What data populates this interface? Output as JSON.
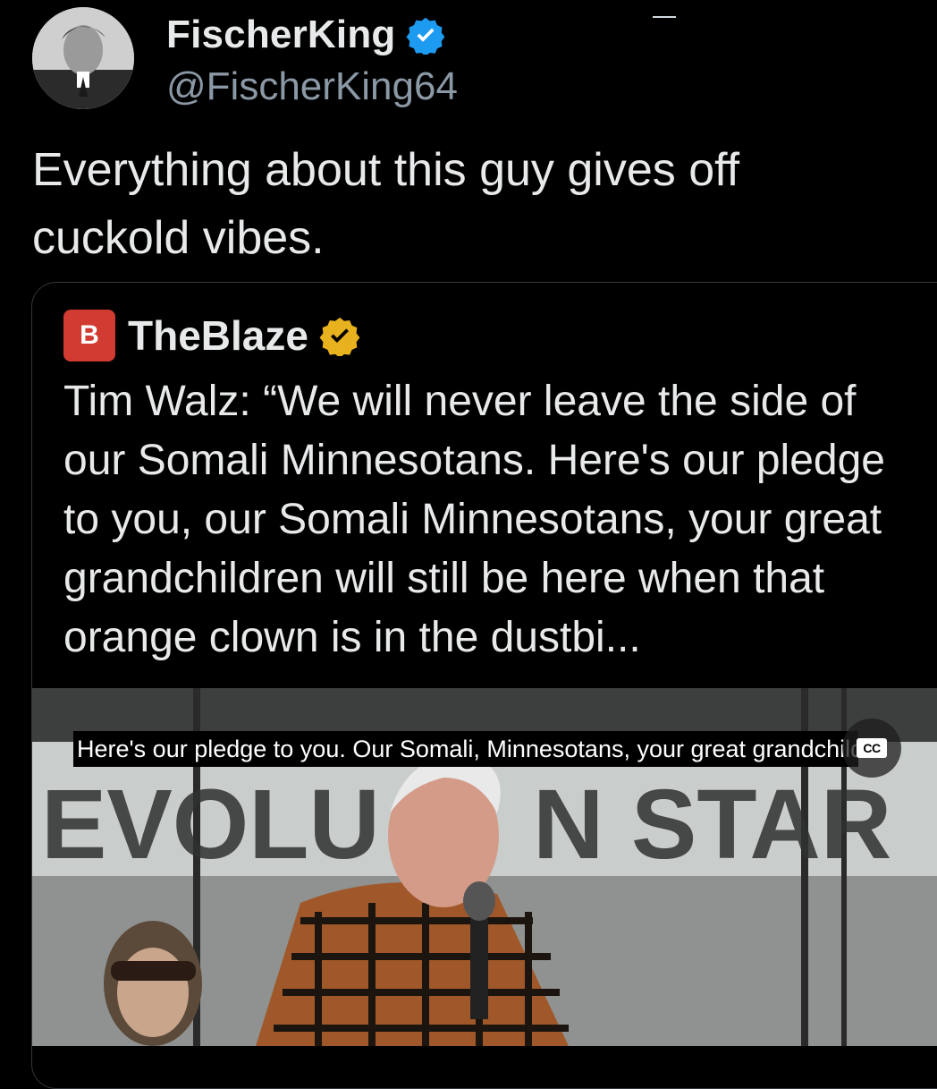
{
  "author": {
    "display_name": "FischerKing",
    "handle": "@FischerKing64",
    "verified_color": "#1d9bf0",
    "avatar_icon": "profile-photo"
  },
  "tweet": {
    "text": "Everything about this guy gives off cuckold vibes."
  },
  "quoted": {
    "logo_text": "B",
    "logo_color": "#d13b32",
    "name": "TheBlaze",
    "badge_color": "#e8b21f",
    "text": "Tim Walz: “We will never leave the side of our Somali Minnesotans. Here's our pledge to you, our Somali Minnesotans, your great grandchildren will still be here when that orange clown is in the dustbi..."
  },
  "video": {
    "caption": "Here's our pledge to you. Our Somali, Minnesotans, your great grandchild",
    "cc_label": "CC"
  }
}
